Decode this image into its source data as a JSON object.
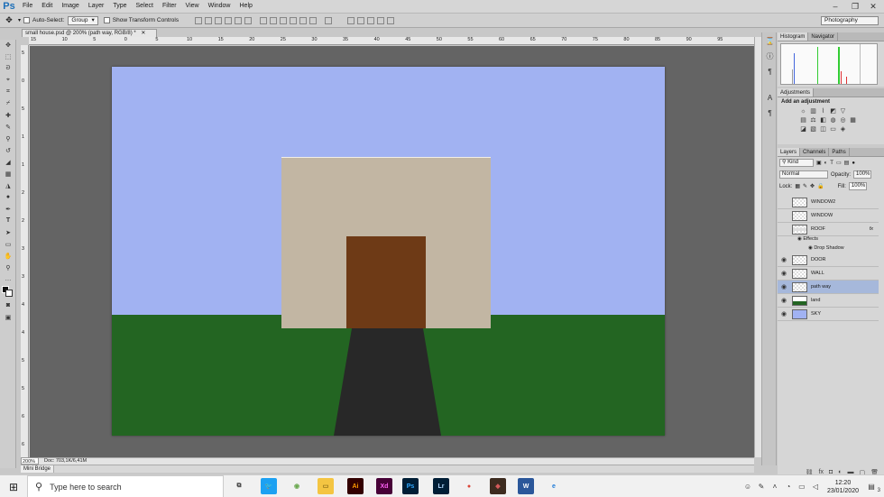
{
  "app": {
    "logo": "Ps"
  },
  "menu": [
    "File",
    "Edit",
    "Image",
    "Layer",
    "Type",
    "Select",
    "Filter",
    "View",
    "Window",
    "Help"
  ],
  "window_controls": {
    "minimize": "–",
    "restore": "❐",
    "close": "✕"
  },
  "options": {
    "auto_select_label": "Auto-Select:",
    "auto_select_value": "Group",
    "show_transform_label": "Show Transform Controls",
    "workspace": "Photography"
  },
  "document": {
    "tab_title": "small house.psd @ 200% (path way, RGB/8) *",
    "zoom": "200%",
    "doc_size": "Doc: 703,1K/6,41M"
  },
  "ruler_h": [
    "15",
    "10",
    "5",
    "0",
    "5",
    "10",
    "15",
    "20",
    "25",
    "30",
    "35",
    "40",
    "45",
    "50",
    "55",
    "60",
    "65",
    "70",
    "75",
    "80",
    "85",
    "90",
    "95"
  ],
  "ruler_v": [
    "5",
    "0",
    "5",
    "1",
    "1",
    "2",
    "2",
    "3",
    "3",
    "4",
    "4",
    "5",
    "5",
    "6",
    "6"
  ],
  "mini_bridge_label": "Mini Bridge",
  "panels": {
    "histogram_tabs": [
      "Histogram",
      "Navigator"
    ],
    "adjustments_tab": "Adjustments",
    "adjustments_subtitle": "Add an adjustment",
    "layers_tabs": [
      "Layers",
      "Channels",
      "Paths"
    ],
    "kind_label": "Kind",
    "blend_mode": "Normal",
    "opacity_label": "Opacity:",
    "opacity_value": "100%",
    "lock_label": "Lock:",
    "fill_label": "Fill:",
    "fill_value": "100%"
  },
  "layers": [
    {
      "name": "WINDOW2",
      "visible": false
    },
    {
      "name": "WINDOW",
      "visible": false
    },
    {
      "name": "ROOF",
      "visible": false,
      "fx": "fx"
    },
    {
      "name": "DOOR",
      "visible": true
    },
    {
      "name": "WALL",
      "visible": true
    },
    {
      "name": "path way",
      "visible": true,
      "selected": true
    },
    {
      "name": "land",
      "visible": true
    },
    {
      "name": "SKY",
      "visible": true
    }
  ],
  "layer_effects": {
    "effects_label": "Effects",
    "drop_shadow_label": "Drop Shadow"
  },
  "taskbar": {
    "search_placeholder": "Type here to search",
    "time": "12:20",
    "date": "23/01/2020",
    "notification_count": "3"
  },
  "taskbar_apps": [
    {
      "name": "task-view",
      "glyph": "⧉",
      "bg": "transparent",
      "fg": "#333"
    },
    {
      "name": "twitter",
      "glyph": "🐦",
      "bg": "#1da1f2",
      "fg": "#fff"
    },
    {
      "name": "maps",
      "glyph": "◉",
      "bg": "transparent",
      "fg": "#6aa84f"
    },
    {
      "name": "file-explorer",
      "glyph": "▭",
      "bg": "#f4c542",
      "fg": "#8a6d1a"
    },
    {
      "name": "illustrator",
      "glyph": "Ai",
      "bg": "#330000",
      "fg": "#ff9a00"
    },
    {
      "name": "xd",
      "glyph": "Xd",
      "bg": "#470137",
      "fg": "#ff61f6"
    },
    {
      "name": "photoshop",
      "glyph": "Ps",
      "bg": "#001e36",
      "fg": "#31a8ff",
      "active": true
    },
    {
      "name": "lightroom",
      "glyph": "Lr",
      "bg": "#001e36",
      "fg": "#b1d9ff"
    },
    {
      "name": "chrome",
      "glyph": "●",
      "bg": "transparent",
      "fg": "#db4437"
    },
    {
      "name": "unknown-app",
      "glyph": "◆",
      "bg": "#3d2b1f",
      "fg": "#d45a5a"
    },
    {
      "name": "word",
      "glyph": "W",
      "bg": "#2b579a",
      "fg": "#fff",
      "active": true
    },
    {
      "name": "edge",
      "glyph": "e",
      "bg": "transparent",
      "fg": "#1f7bd8"
    }
  ],
  "colors": {
    "sky": "#a1b2f2",
    "land": "#236522",
    "wall": "#c2b6a3",
    "door": "#6e3a16",
    "path": "#282828",
    "canvas_bg": "#646464",
    "selected_layer": "#a6b8db"
  }
}
